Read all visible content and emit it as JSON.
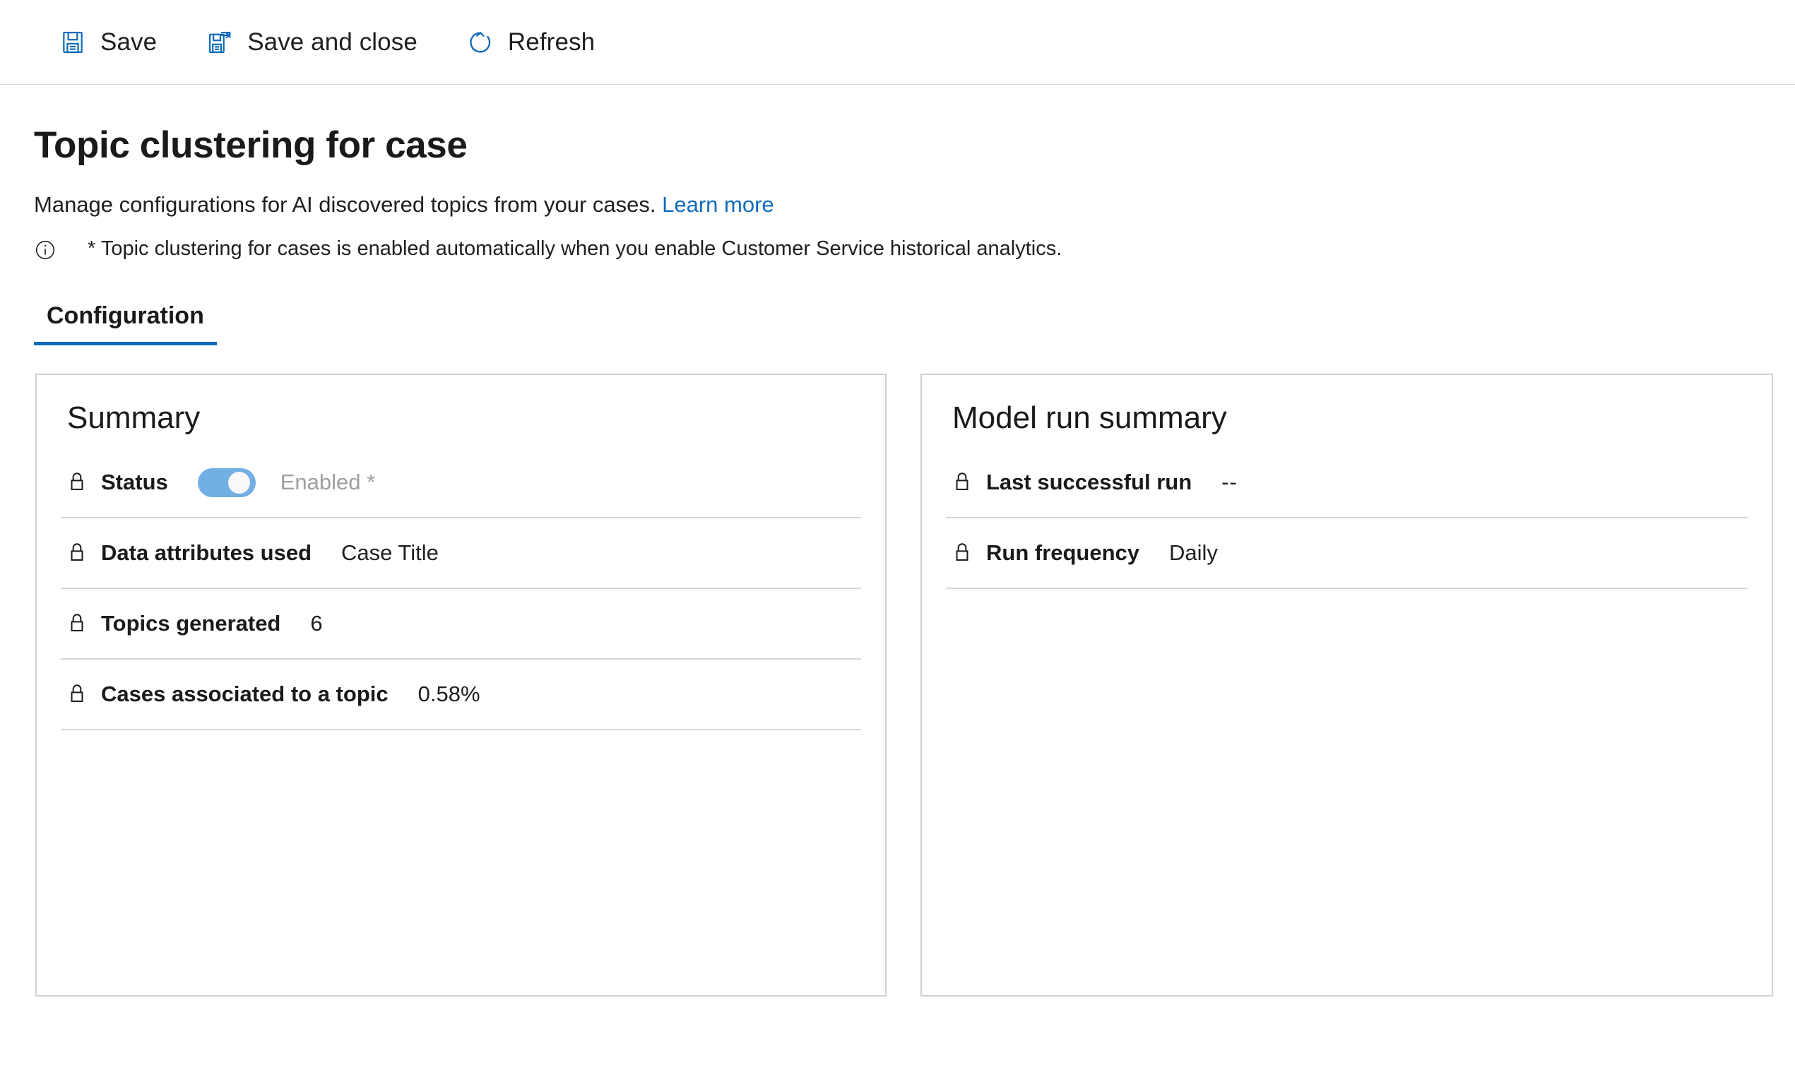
{
  "toolbar": {
    "buttons": [
      {
        "label": "Save",
        "icon": "save-icon"
      },
      {
        "label": "Save and close",
        "icon": "save-and-close-icon"
      },
      {
        "label": "Refresh",
        "icon": "refresh-icon"
      }
    ]
  },
  "header": {
    "title": "Topic clustering for case",
    "subtitle": "Manage configurations for AI discovered topics from your cases.",
    "learn_more_label": "Learn more",
    "info_icon": "info-icon",
    "info_text": "* Topic clustering for cases is enabled automatically when you enable Customer Service historical analytics."
  },
  "tabs": [
    {
      "label": "Configuration",
      "active": true
    }
  ],
  "summary_card": {
    "title": "Summary",
    "status": {
      "label": "Status",
      "toggle_on": true,
      "toggle_text": "Enabled *",
      "lock_icon": "lock-icon"
    },
    "rows": [
      {
        "label": "Data attributes used",
        "value": "Case Title",
        "lock_icon": "lock-icon"
      },
      {
        "label": "Topics generated",
        "value": "6",
        "lock_icon": "lock-icon"
      },
      {
        "label": "Cases associated to a topic",
        "value": "0.58%",
        "lock_icon": "lock-icon"
      }
    ]
  },
  "model_run_card": {
    "title": "Model run summary",
    "rows": [
      {
        "label": "Last successful run",
        "value": "--",
        "lock_icon": "lock-icon"
      },
      {
        "label": "Run frequency",
        "value": "Daily",
        "lock_icon": "lock-icon"
      }
    ]
  },
  "colors": {
    "accent": "#0f6cbd",
    "toggle_on": "#71afe5",
    "muted_text": "#a19f9d",
    "border": "#d2d0ce"
  }
}
